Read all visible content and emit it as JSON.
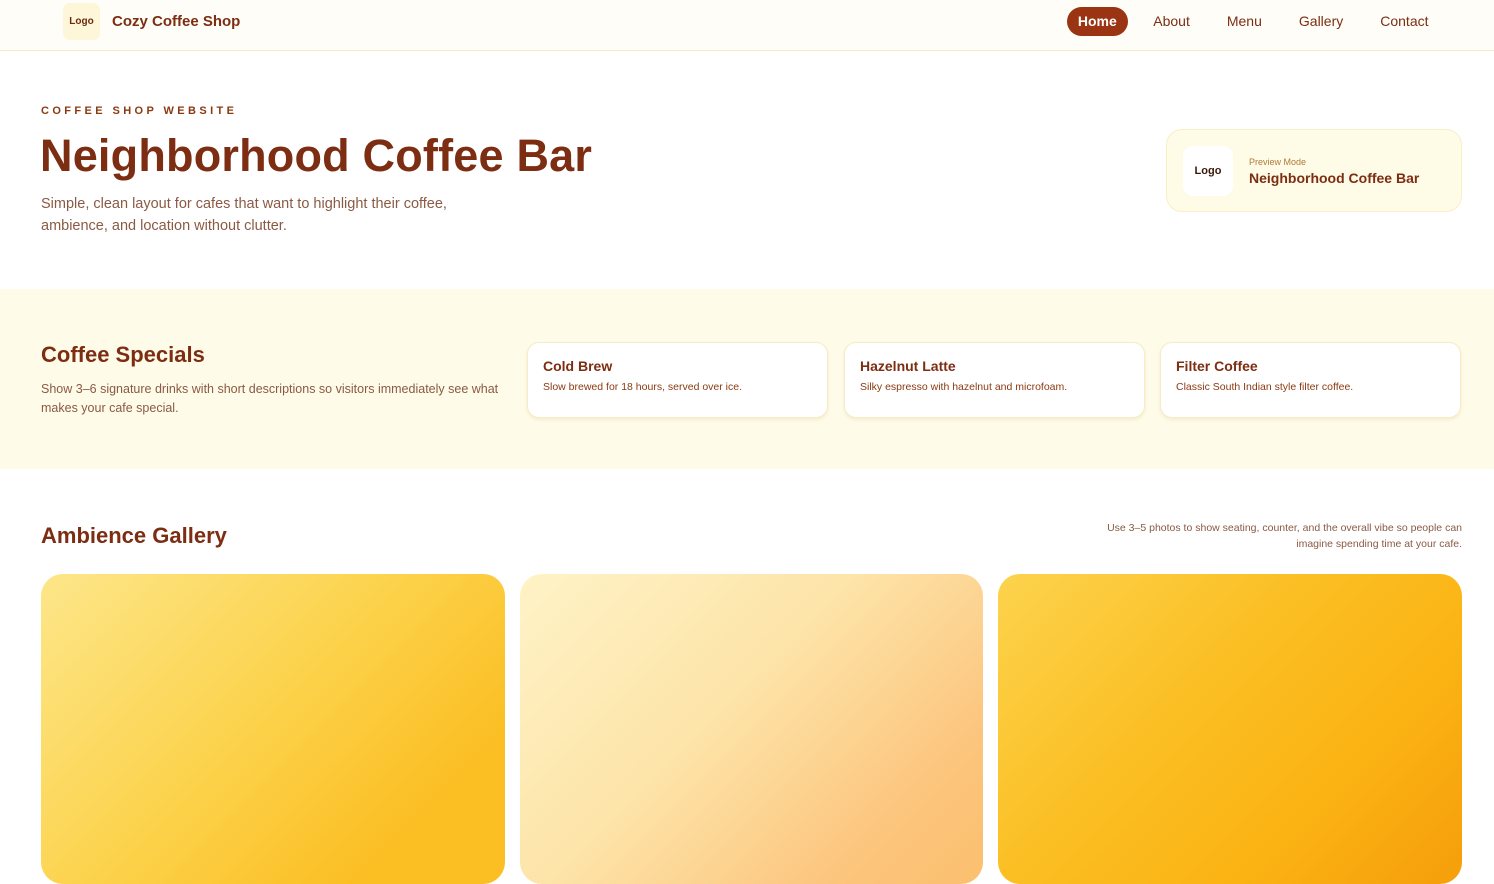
{
  "header": {
    "logo_text": "Logo",
    "brand_name": "Cozy Coffee Shop",
    "nav": [
      {
        "label": "Home",
        "active": true
      },
      {
        "label": "About",
        "active": false
      },
      {
        "label": "Menu",
        "active": false
      },
      {
        "label": "Gallery",
        "active": false
      },
      {
        "label": "Contact",
        "active": false
      }
    ]
  },
  "hero": {
    "eyebrow": "COFFEE SHOP WEBSITE",
    "title": "Neighborhood Coffee Bar",
    "subtitle": "Simple, clean layout for cafes that want to highlight their coffee, ambience, and location without clutter."
  },
  "preview": {
    "logo_text": "Logo",
    "label": "Preview Mode",
    "name": "Neighborhood Coffee Bar"
  },
  "specials": {
    "title": "Coffee Specials",
    "description": "Show 3–6 signature drinks with short descriptions so visitors immediately see what makes your cafe special.",
    "items": [
      {
        "name": "Cold Brew",
        "description": "Slow brewed for 18 hours, served over ice."
      },
      {
        "name": "Hazelnut Latte",
        "description": "Silky espresso with hazelnut and microfoam."
      },
      {
        "name": "Filter Coffee",
        "description": "Classic South Indian style filter coffee."
      }
    ]
  },
  "gallery": {
    "title": "Ambience Gallery",
    "note": "Use 3–5 photos to show seating, counter, and the overall vibe so people can imagine spending time at your cafe."
  },
  "colors": {
    "accent": "#9a3412",
    "heading": "#7c2d12",
    "band_background": "#fefbe9"
  }
}
